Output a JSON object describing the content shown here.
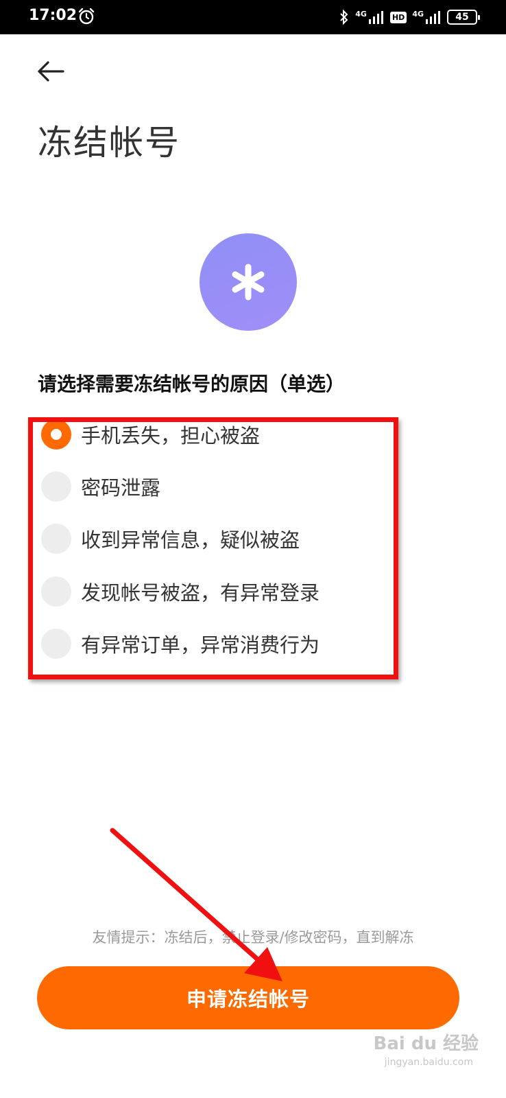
{
  "status_bar": {
    "time": "17:02",
    "network_1": "4G",
    "hd": "HD",
    "network_2": "4G",
    "battery": "45",
    "icons": [
      "alarm-icon",
      "bluetooth-icon",
      "signal-icon",
      "signal-icon",
      "battery-icon"
    ]
  },
  "header": {
    "back_icon": "arrow-left-icon",
    "title": "冻结帐号"
  },
  "hero": {
    "icon": "asterisk-icon",
    "color": "#9b8ff7"
  },
  "question": "请选择需要冻结帐号的原因（单选）",
  "options": [
    {
      "label": "手机丢失，担心被盗",
      "selected": true
    },
    {
      "label": "密码泄露",
      "selected": false
    },
    {
      "label": "收到异常信息，疑似被盗",
      "selected": false
    },
    {
      "label": "发现帐号被盗，有异常登录",
      "selected": false
    },
    {
      "label": "有异常订单，异常消费行为",
      "selected": false
    }
  ],
  "tip": "友情提示：冻结后，禁止登录/修改密码，直到解冻",
  "submit_label": "申请冻结帐号",
  "colors": {
    "accent": "#ff6a00",
    "annotation_red": "#f01010"
  },
  "watermark": {
    "brand": "Bai du 经验",
    "url": "jingyan.baidu.com"
  }
}
